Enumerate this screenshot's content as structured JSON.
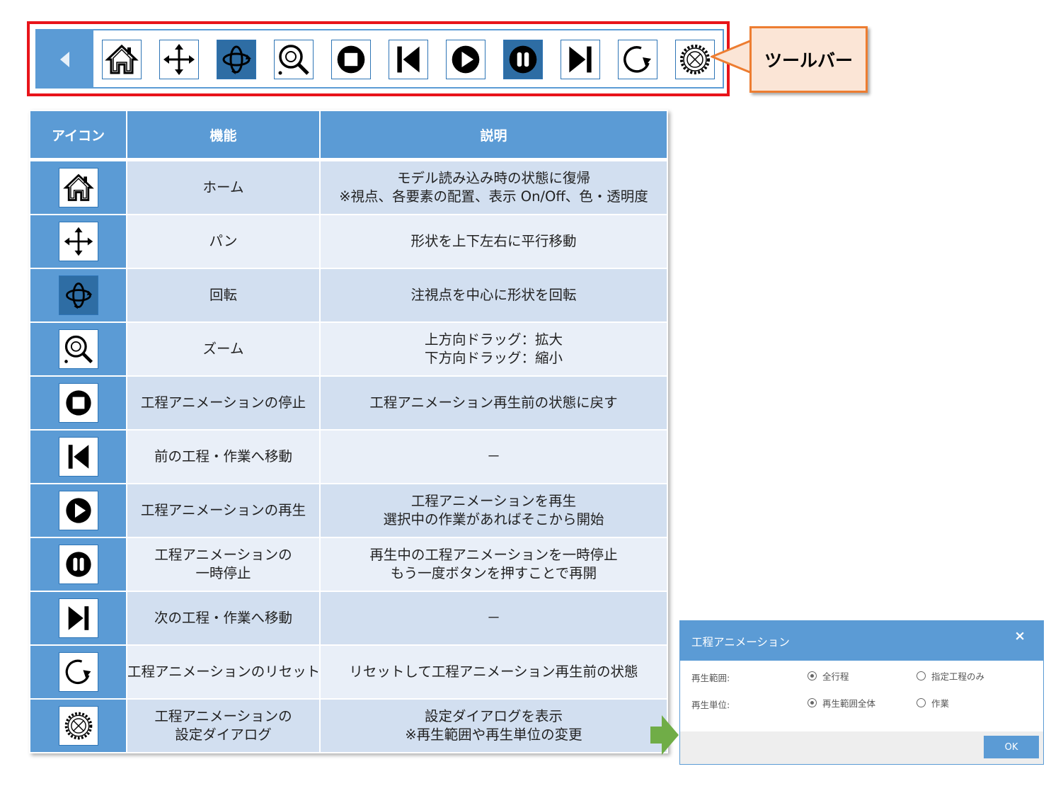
{
  "callout": {
    "label": "ツールバー"
  },
  "toolbar": {
    "buttons": [
      {
        "name": "home",
        "icon": "home-icon"
      },
      {
        "name": "pan",
        "icon": "pan-arrows-icon"
      },
      {
        "name": "rotate",
        "icon": "rotate-icon",
        "selected": true
      },
      {
        "name": "zoom",
        "icon": "zoom-icon"
      },
      {
        "name": "stop",
        "icon": "stop-icon"
      },
      {
        "name": "previous",
        "icon": "skip-previous-icon"
      },
      {
        "name": "play",
        "icon": "play-icon"
      },
      {
        "name": "pause",
        "icon": "pause-icon",
        "selected": true
      },
      {
        "name": "next",
        "icon": "skip-next-icon"
      },
      {
        "name": "reset",
        "icon": "reset-icon"
      },
      {
        "name": "settings",
        "icon": "settings-gear-icon"
      }
    ]
  },
  "table": {
    "headers": {
      "icon": "アイコン",
      "function": "機能",
      "description": "説明"
    },
    "rows": [
      {
        "function": [
          "ホーム"
        ],
        "description": [
          "モデル読み込み時の状態に復帰",
          "※視点、各要素の配置、表示 On/Off、色・透明度"
        ]
      },
      {
        "function": [
          "パン"
        ],
        "description": [
          "形状を上下左右に平行移動"
        ]
      },
      {
        "function": [
          "回転"
        ],
        "description": [
          "注視点を中心に形状を回転"
        ]
      },
      {
        "function": [
          "ズーム"
        ],
        "description": [
          "上方向ドラッグ：拡大",
          "下方向ドラッグ：縮小"
        ]
      },
      {
        "function": [
          "工程アニメーションの停止"
        ],
        "description": [
          "工程アニメーション再生前の状態に戻す"
        ]
      },
      {
        "function": [
          "前の工程・作業へ移動"
        ],
        "description": [
          "－"
        ]
      },
      {
        "function": [
          "工程アニメーションの再生"
        ],
        "description": [
          "工程アニメーションを再生",
          "選択中の作業があればそこから開始"
        ]
      },
      {
        "function": [
          "工程アニメーションの",
          "一時停止"
        ],
        "description": [
          "再生中の工程アニメーションを一時停止",
          "もう一度ボタンを押すことで再開"
        ]
      },
      {
        "function": [
          "次の工程・作業へ移動"
        ],
        "description": [
          "－"
        ]
      },
      {
        "function": [
          "工程アニメーションのリセット"
        ],
        "description": [
          "リセットして工程アニメーション再生前の状態"
        ]
      },
      {
        "function": [
          "工程アニメーションの",
          "設定ダイアログ"
        ],
        "description": [
          "設定ダイアログを表示",
          "※再生範囲や再生単位の変更"
        ]
      }
    ]
  },
  "dialog": {
    "title": "工程アニメーション",
    "close": "×",
    "range_label": "再生範囲:",
    "range_options": [
      {
        "label": "全行程",
        "checked": true
      },
      {
        "label": "指定工程のみ",
        "checked": false
      }
    ],
    "unit_label": "再生単位:",
    "unit_options": [
      {
        "label": "再生範囲全体",
        "checked": true
      },
      {
        "label": "作業",
        "checked": false
      }
    ],
    "ok": "OK"
  },
  "colors": {
    "accent": "#5b9bd5",
    "dark_button": "#2e6da4",
    "frame_red": "#e8141a",
    "callout_border": "#ed7d31",
    "callout_fill": "#fbe5d6",
    "arrow_green": "#70ad47"
  }
}
